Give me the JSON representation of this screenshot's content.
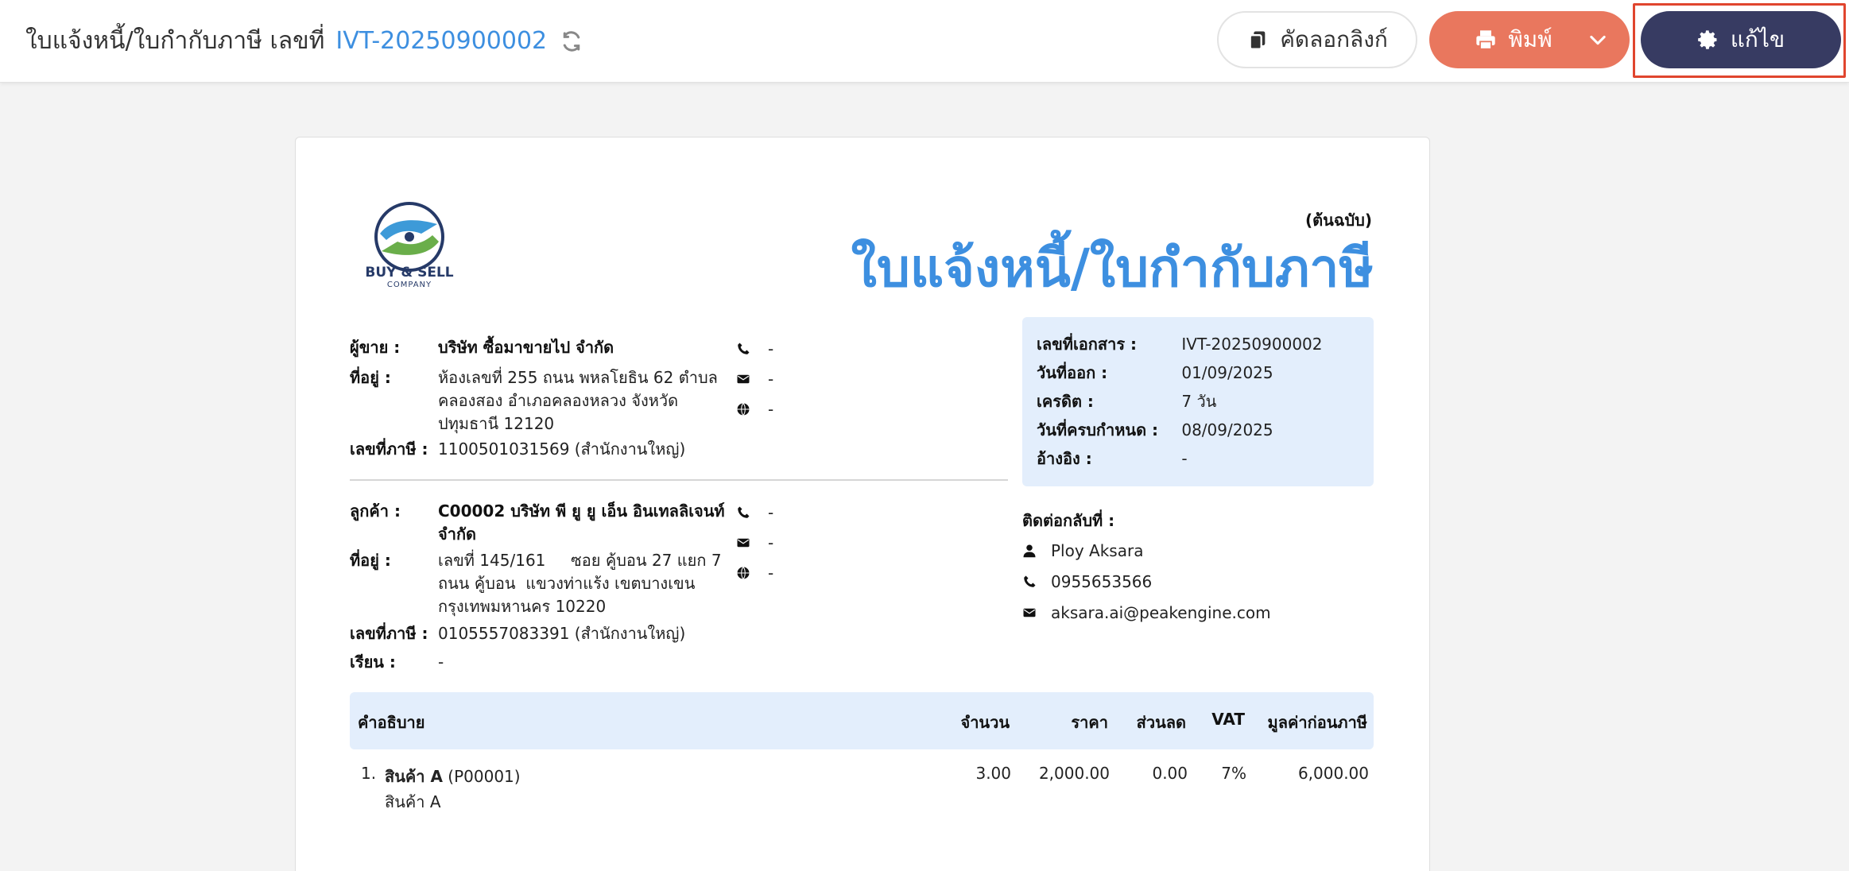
{
  "header": {
    "title": "ใบแจ้งหนี้/ใบกำกับภาษี เลขที่",
    "doc_no": "IVT-20250900002",
    "copy_label": "คัดลอกลิงก์",
    "print_label": "พิมพ์",
    "edit_label": "แก้ไข"
  },
  "document": {
    "logo": {
      "line1": "BUY & SELL",
      "line2": "COMPANY"
    },
    "copy_type": "(ต้นฉบับ)",
    "title": "ใบแจ้งหนี้/ใบกำกับภาษี",
    "seller": {
      "label": "ผู้ขาย :",
      "name": "บริษัท ซื้อมาขายไป จำกัด",
      "address_label": "ที่อยู่ :",
      "address_l1": "ห้องเลขที่ 255 ถนน พหลโยธิน 62 ตำบล",
      "address_l2": "คลองสอง อำเภอคลองหลวง จังหวัด",
      "address_l3": "ปทุมธานี 12120",
      "tax_label": "เลขที่ภาษี :",
      "tax_id": "1100501031569 (สำนักงานใหญ่)",
      "phone": "-",
      "email": "-",
      "web": "-"
    },
    "customer": {
      "label": "ลูกค้า :",
      "name_l1": "C00002 บริษัท พี ยู ยู เอ็น อินเทลลิเจนท์",
      "name_l2": "จำกัด",
      "address_label": "ที่อยู่ :",
      "address_l1": "เลขที่ 145/161     ซอย คู้บอน 27 แยก 7",
      "address_l2": "ถนน คู้บอน  แขวงท่าแร้ง เขตบางเขน",
      "address_l3": "กรุงเทพมหานคร 10220",
      "tax_label": "เลขที่ภาษี :",
      "tax_id": "0105557083391 (สำนักงานใหญ่)",
      "attn_label": "เรียน :",
      "attn": "-",
      "phone": "-",
      "email": "-",
      "web": "-"
    },
    "info": {
      "doc_no_label": "เลขที่เอกสาร :",
      "doc_no": "IVT-20250900002",
      "issue_label": "วันที่ออก :",
      "issue_date": "01/09/2025",
      "credit_label": "เครดิต :",
      "credit": "7 วัน",
      "due_label": "วันที่ครบกำหนด :",
      "due_date": "08/09/2025",
      "ref_label": "อ้างอิง :",
      "ref": "-"
    },
    "contact": {
      "title": "ติดต่อกลับที่ :",
      "name": "Ploy Aksara",
      "phone": "0955653566",
      "email": "aksara.ai@peakengine.com"
    },
    "table": {
      "headers": {
        "desc": "คำอธิบาย",
        "qty": "จำนวน",
        "price": "ราคา",
        "discount": "ส่วนลด",
        "vat": "VAT",
        "amount": "มูลค่าก่อนภาษี"
      },
      "rows": [
        {
          "no": "1.",
          "name": "สินค้า A",
          "code": "(P00001)",
          "sub": "สินค้า A",
          "qty": "3.00",
          "price": "2,000.00",
          "discount": "0.00",
          "vat": "7%",
          "amount": "6,000.00"
        }
      ]
    }
  }
}
